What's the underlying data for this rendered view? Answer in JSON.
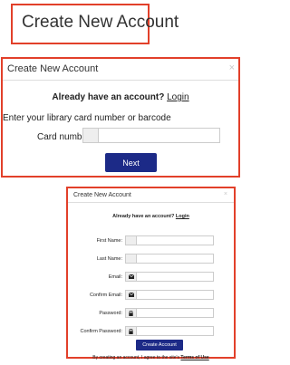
{
  "step1": {
    "title": "Create New Account"
  },
  "step2": {
    "title": "Create New Account",
    "close": "×",
    "already_prefix": "Already have an account?",
    "login": "Login",
    "instruction": "Enter your library card number or barcode",
    "card_label": "Card number:",
    "next": "Next"
  },
  "step3": {
    "title": "Create New Account",
    "close": "×",
    "already_prefix": "Already have an account?",
    "login": "Login",
    "fields": [
      {
        "label": "First Name:",
        "icon": ""
      },
      {
        "label": "Last Name:",
        "icon": ""
      },
      {
        "label": "Email:",
        "icon": "envelope-icon"
      },
      {
        "label": "Confirm Email:",
        "icon": "envelope-icon"
      },
      {
        "label": "Password:",
        "icon": "lock-icon"
      },
      {
        "label": "Confirm Password:",
        "icon": "lock-icon"
      }
    ],
    "create": "Create Account",
    "terms_prefix": "By creating an account, I agree to the site's",
    "terms_link": "Terms of Use"
  },
  "colors": {
    "highlight_border": "#e2402a",
    "button_bg": "#1c2a87"
  }
}
